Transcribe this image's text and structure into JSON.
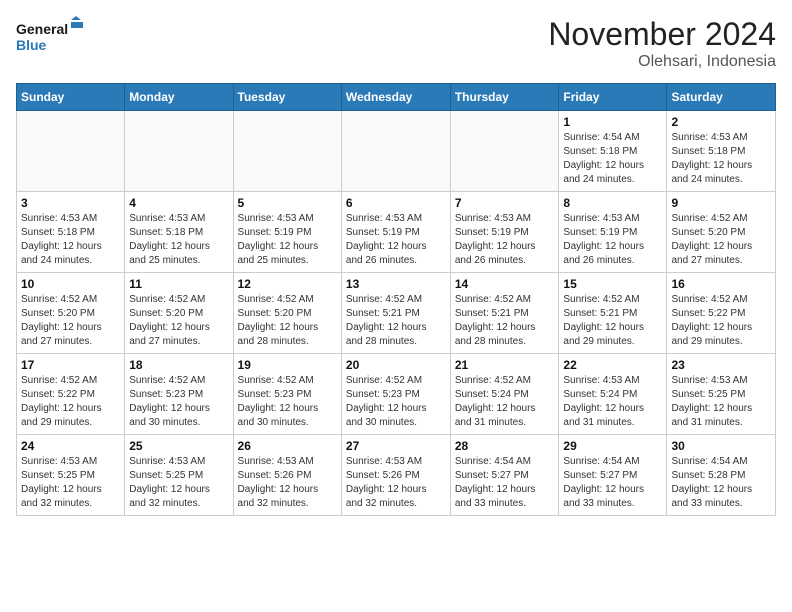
{
  "logo": {
    "line1": "General",
    "line2": "Blue"
  },
  "title": "November 2024",
  "location": "Olehsari, Indonesia",
  "weekdays": [
    "Sunday",
    "Monday",
    "Tuesday",
    "Wednesday",
    "Thursday",
    "Friday",
    "Saturday"
  ],
  "weeks": [
    [
      {
        "day": "",
        "info": ""
      },
      {
        "day": "",
        "info": ""
      },
      {
        "day": "",
        "info": ""
      },
      {
        "day": "",
        "info": ""
      },
      {
        "day": "",
        "info": ""
      },
      {
        "day": "1",
        "info": "Sunrise: 4:54 AM\nSunset: 5:18 PM\nDaylight: 12 hours\nand 24 minutes."
      },
      {
        "day": "2",
        "info": "Sunrise: 4:53 AM\nSunset: 5:18 PM\nDaylight: 12 hours\nand 24 minutes."
      }
    ],
    [
      {
        "day": "3",
        "info": "Sunrise: 4:53 AM\nSunset: 5:18 PM\nDaylight: 12 hours\nand 24 minutes."
      },
      {
        "day": "4",
        "info": "Sunrise: 4:53 AM\nSunset: 5:18 PM\nDaylight: 12 hours\nand 25 minutes."
      },
      {
        "day": "5",
        "info": "Sunrise: 4:53 AM\nSunset: 5:19 PM\nDaylight: 12 hours\nand 25 minutes."
      },
      {
        "day": "6",
        "info": "Sunrise: 4:53 AM\nSunset: 5:19 PM\nDaylight: 12 hours\nand 26 minutes."
      },
      {
        "day": "7",
        "info": "Sunrise: 4:53 AM\nSunset: 5:19 PM\nDaylight: 12 hours\nand 26 minutes."
      },
      {
        "day": "8",
        "info": "Sunrise: 4:53 AM\nSunset: 5:19 PM\nDaylight: 12 hours\nand 26 minutes."
      },
      {
        "day": "9",
        "info": "Sunrise: 4:52 AM\nSunset: 5:20 PM\nDaylight: 12 hours\nand 27 minutes."
      }
    ],
    [
      {
        "day": "10",
        "info": "Sunrise: 4:52 AM\nSunset: 5:20 PM\nDaylight: 12 hours\nand 27 minutes."
      },
      {
        "day": "11",
        "info": "Sunrise: 4:52 AM\nSunset: 5:20 PM\nDaylight: 12 hours\nand 27 minutes."
      },
      {
        "day": "12",
        "info": "Sunrise: 4:52 AM\nSunset: 5:20 PM\nDaylight: 12 hours\nand 28 minutes."
      },
      {
        "day": "13",
        "info": "Sunrise: 4:52 AM\nSunset: 5:21 PM\nDaylight: 12 hours\nand 28 minutes."
      },
      {
        "day": "14",
        "info": "Sunrise: 4:52 AM\nSunset: 5:21 PM\nDaylight: 12 hours\nand 28 minutes."
      },
      {
        "day": "15",
        "info": "Sunrise: 4:52 AM\nSunset: 5:21 PM\nDaylight: 12 hours\nand 29 minutes."
      },
      {
        "day": "16",
        "info": "Sunrise: 4:52 AM\nSunset: 5:22 PM\nDaylight: 12 hours\nand 29 minutes."
      }
    ],
    [
      {
        "day": "17",
        "info": "Sunrise: 4:52 AM\nSunset: 5:22 PM\nDaylight: 12 hours\nand 29 minutes."
      },
      {
        "day": "18",
        "info": "Sunrise: 4:52 AM\nSunset: 5:23 PM\nDaylight: 12 hours\nand 30 minutes."
      },
      {
        "day": "19",
        "info": "Sunrise: 4:52 AM\nSunset: 5:23 PM\nDaylight: 12 hours\nand 30 minutes."
      },
      {
        "day": "20",
        "info": "Sunrise: 4:52 AM\nSunset: 5:23 PM\nDaylight: 12 hours\nand 30 minutes."
      },
      {
        "day": "21",
        "info": "Sunrise: 4:52 AM\nSunset: 5:24 PM\nDaylight: 12 hours\nand 31 minutes."
      },
      {
        "day": "22",
        "info": "Sunrise: 4:53 AM\nSunset: 5:24 PM\nDaylight: 12 hours\nand 31 minutes."
      },
      {
        "day": "23",
        "info": "Sunrise: 4:53 AM\nSunset: 5:25 PM\nDaylight: 12 hours\nand 31 minutes."
      }
    ],
    [
      {
        "day": "24",
        "info": "Sunrise: 4:53 AM\nSunset: 5:25 PM\nDaylight: 12 hours\nand 32 minutes."
      },
      {
        "day": "25",
        "info": "Sunrise: 4:53 AM\nSunset: 5:25 PM\nDaylight: 12 hours\nand 32 minutes."
      },
      {
        "day": "26",
        "info": "Sunrise: 4:53 AM\nSunset: 5:26 PM\nDaylight: 12 hours\nand 32 minutes."
      },
      {
        "day": "27",
        "info": "Sunrise: 4:53 AM\nSunset: 5:26 PM\nDaylight: 12 hours\nand 32 minutes."
      },
      {
        "day": "28",
        "info": "Sunrise: 4:54 AM\nSunset: 5:27 PM\nDaylight: 12 hours\nand 33 minutes."
      },
      {
        "day": "29",
        "info": "Sunrise: 4:54 AM\nSunset: 5:27 PM\nDaylight: 12 hours\nand 33 minutes."
      },
      {
        "day": "30",
        "info": "Sunrise: 4:54 AM\nSunset: 5:28 PM\nDaylight: 12 hours\nand 33 minutes."
      }
    ]
  ]
}
